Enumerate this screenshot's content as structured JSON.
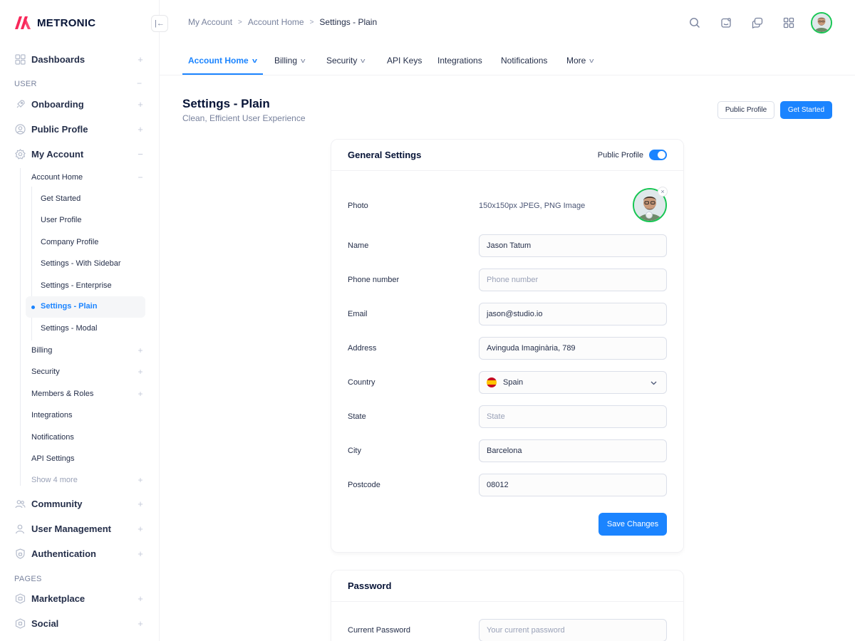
{
  "brand": {
    "name": "METRONIC"
  },
  "breadcrumb": [
    "My Account",
    "Account Home",
    "Settings - Plain"
  ],
  "sidebar": {
    "dashboards": "Dashboards",
    "section_user": "USER",
    "onboarding": "Onboarding",
    "public_profile": "Public Profle",
    "my_account": "My Account",
    "account_home": "Account Home",
    "account_home_items": [
      "Get Started",
      "User Profile",
      "Company Profile",
      "Settings - With Sidebar",
      "Settings - Enterprise",
      "Settings - Plain",
      "Settings - Modal"
    ],
    "billing": "Billing",
    "security": "Security",
    "members_roles": "Members & Roles",
    "integrations": "Integrations",
    "notifications": "Notifications",
    "api_settings": "API Settings",
    "show_more": "Show 4 more",
    "community": "Community",
    "user_management": "User Management",
    "authentication": "Authentication",
    "section_pages": "PAGES",
    "marketplace": "Marketplace",
    "social": "Social"
  },
  "tabs": [
    "Account Home",
    "Billing",
    "Security",
    "API Keys",
    "Integrations",
    "Notifications",
    "More"
  ],
  "page": {
    "title": "Settings - Plain",
    "subtitle": "Clean, Efficient User Experience",
    "public_profile_btn": "Public Profile",
    "get_started_btn": "Get Started"
  },
  "general": {
    "title": "General Settings",
    "toggle_label": "Public Profile",
    "toggle_on": true,
    "photo_label": "Photo",
    "photo_hint": "150x150px JPEG, PNG Image",
    "name_label": "Name",
    "name_value": "Jason Tatum",
    "phone_label": "Phone number",
    "phone_placeholder": "Phone number",
    "email_label": "Email",
    "email_value": "jason@studio.io",
    "address_label": "Address",
    "address_value": "Avinguda Imaginària, 789",
    "country_label": "Country",
    "country_value": "Spain",
    "state_label": "State",
    "state_placeholder": "State",
    "city_label": "City",
    "city_value": "Barcelona",
    "postcode_label": "Postcode",
    "postcode_value": "08012",
    "save_label": "Save Changes"
  },
  "password": {
    "title": "Password",
    "current_label": "Current Password",
    "current_placeholder": "Your current password"
  },
  "colors": {
    "primary": "#1b84ff",
    "brand": "#f8285a",
    "success": "#17c653"
  }
}
